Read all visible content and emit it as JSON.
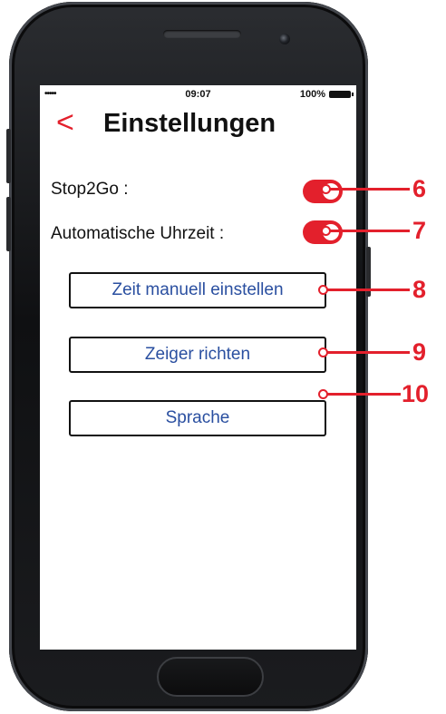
{
  "status_bar": {
    "signal": "•••••",
    "time": "09:07",
    "battery_pct": "100%"
  },
  "header": {
    "back_glyph": "<",
    "title": "Einstellungen"
  },
  "settings": {
    "stop2go_label": "Stop2Go :",
    "stop2go_on": true,
    "auto_time_label": "Automatische Uhrzeit :",
    "auto_time_on": true
  },
  "buttons": {
    "manual_time": "Zeit manuell einstellen",
    "align_hands": "Zeiger richten",
    "language": "Sprache"
  },
  "callouts": [
    "6",
    "7",
    "8",
    "9",
    "10"
  ],
  "colors": {
    "accent": "#e3202c",
    "button_text": "#2a4fa0"
  }
}
